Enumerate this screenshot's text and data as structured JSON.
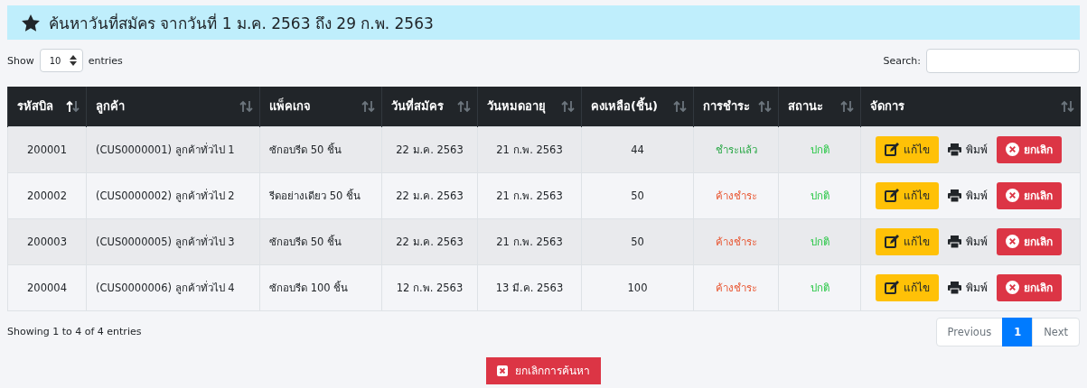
{
  "title": "ค้นหาวันที่สมัคร จากวันที่ 1 ม.ค. 2563 ถึง 29 ก.พ. 2563",
  "length_control": {
    "before": "Show",
    "value": "10",
    "after": "entries"
  },
  "search": {
    "label": "Search:"
  },
  "table": {
    "columns": [
      {
        "label": "รหัสบิล",
        "sorted": true
      },
      {
        "label": "ลูกค้า",
        "sorted": false
      },
      {
        "label": "แพ็คเกจ",
        "sorted": false
      },
      {
        "label": "วันที่สมัคร",
        "sorted": false
      },
      {
        "label": "วันหมดอายุ",
        "sorted": false
      },
      {
        "label": "คงเหลือ(ชิ้น)",
        "sorted": false
      },
      {
        "label": "การชำระ",
        "sorted": false
      },
      {
        "label": "สถานะ",
        "sorted": false
      },
      {
        "label": "จัดการ",
        "sorted": false
      }
    ],
    "rows": [
      {
        "bill": "200001",
        "customer": "(CUS0000001) ลูกค้าทั่วไป 1",
        "package": "ซักอบรีด 50 ชิ้น",
        "start": "22 ม.ค. 2563",
        "end": "21 ก.พ. 2563",
        "remaining": "44",
        "payment": {
          "text": "ชำระแล้ว",
          "kind": "paid"
        },
        "status": {
          "text": "ปกติ",
          "kind": "normal"
        },
        "actions": [
          "แก้ไข",
          "พิมพ์",
          "ยกเลิก"
        ]
      },
      {
        "bill": "200002",
        "customer": "(CUS0000002) ลูกค้าทั่วไป 2",
        "package": "รีดอย่างเดียว 50 ชิ้น",
        "start": "22 ม.ค. 2563",
        "end": "21 ก.พ. 2563",
        "remaining": "50",
        "payment": {
          "text": "ค้างชำระ",
          "kind": "unpaid"
        },
        "status": {
          "text": "ปกติ",
          "kind": "normal"
        },
        "actions": [
          "แก้ไข",
          "พิมพ์",
          "ยกเลิก"
        ]
      },
      {
        "bill": "200003",
        "customer": "(CUS0000005) ลูกค้าทั่วไป 3",
        "package": "ซักอบรีด 50 ชิ้น",
        "start": "22 ม.ค. 2563",
        "end": "21 ก.พ. 2563",
        "remaining": "50",
        "payment": {
          "text": "ค้างชำระ",
          "kind": "unpaid"
        },
        "status": {
          "text": "ปกติ",
          "kind": "normal"
        },
        "actions": [
          "แก้ไข",
          "พิมพ์",
          "ยกเลิก"
        ]
      },
      {
        "bill": "200004",
        "customer": "(CUS0000006) ลูกค้าทั่วไป 4",
        "package": "ซักอบรีด 100 ชิ้น",
        "start": "12 ก.พ. 2563",
        "end": "13 มี.ค. 2563",
        "remaining": "100",
        "payment": {
          "text": "ค้างชำระ",
          "kind": "unpaid"
        },
        "status": {
          "text": "ปกติ",
          "kind": "normal"
        },
        "actions": [
          "แก้ไข",
          "พิมพ์",
          "ยกเลิก"
        ]
      }
    ]
  },
  "info": "Showing 1 to 4 of 4 entries",
  "pagination": [
    {
      "label": "Previous",
      "selected": false
    },
    {
      "label": "1",
      "selected": true
    },
    {
      "label": "Next",
      "selected": false
    }
  ],
  "cancel_search": "ยกเลิกการค้นหา"
}
